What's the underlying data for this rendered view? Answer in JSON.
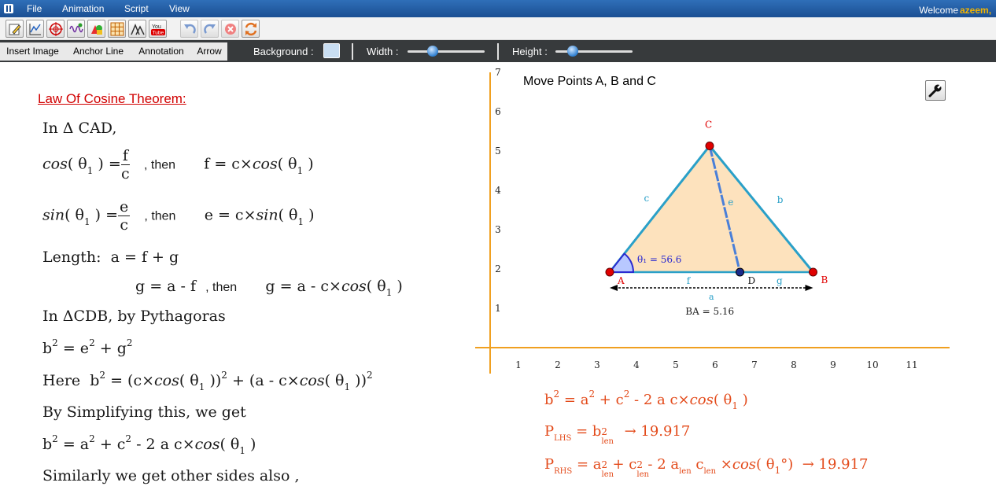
{
  "menu": {
    "items": [
      "File",
      "Animation",
      "Script",
      "View"
    ],
    "welcome": "Welcome",
    "user": "azeem,"
  },
  "propbar": {
    "insert_image": "Insert Image",
    "anchor_line": "Anchor Line",
    "annotation": "Annotation",
    "arrow": "Arrow",
    "background_label": "Background :",
    "width_label": "Width :",
    "height_label": "Height :",
    "background_color": "#c9def2",
    "width_value": 0.33,
    "height_value": 0.22
  },
  "law": {
    "title": "Law Of Cosine Theorem:",
    "line1": "In  Δ  CAD,",
    "then": ", then",
    "length_label": "Length:",
    "length_eq": "a = f + g",
    "g_eq": "g = a - f",
    "in_cdb": "In  ΔCDB,   by  Pythagoras",
    "here": "Here",
    "simplify": "By  Simplifying  this,  we  get",
    "similarly": "Similarly  we  get  other  sides  also ,"
  },
  "graph": {
    "title": "Move Points A, B and C",
    "x_ticks": [
      "1",
      "2",
      "3",
      "4",
      "5",
      "6",
      "7",
      "8",
      "9",
      "10",
      "11"
    ],
    "y_ticks": [
      "1",
      "2",
      "3",
      "4",
      "5",
      "6",
      "7"
    ],
    "points": {
      "A": [
        3.5,
        2.0
      ],
      "B": [
        8.65,
        2.0
      ],
      "C": [
        6.7,
        5.35
      ],
      "D": [
        6.05,
        2.0
      ]
    },
    "labels": {
      "A": "A",
      "B": "B",
      "C": "C",
      "D": "D",
      "a": "a",
      "b": "b",
      "c": "c",
      "e": "e",
      "f": "f",
      "g": "g"
    },
    "angle_label": "θ₁ = 56.6",
    "ba_label": "BA = 5.16",
    "colors": {
      "axis": "#f0a020",
      "side": "#2aa0c8",
      "fill": "#fde2bd",
      "point": "#e00000",
      "altitude": "#4a7fd8",
      "angle": "#2a2ad0"
    }
  },
  "results": {
    "lhs_value": "→ 19.917",
    "rhs_value": "→ 19.917"
  }
}
